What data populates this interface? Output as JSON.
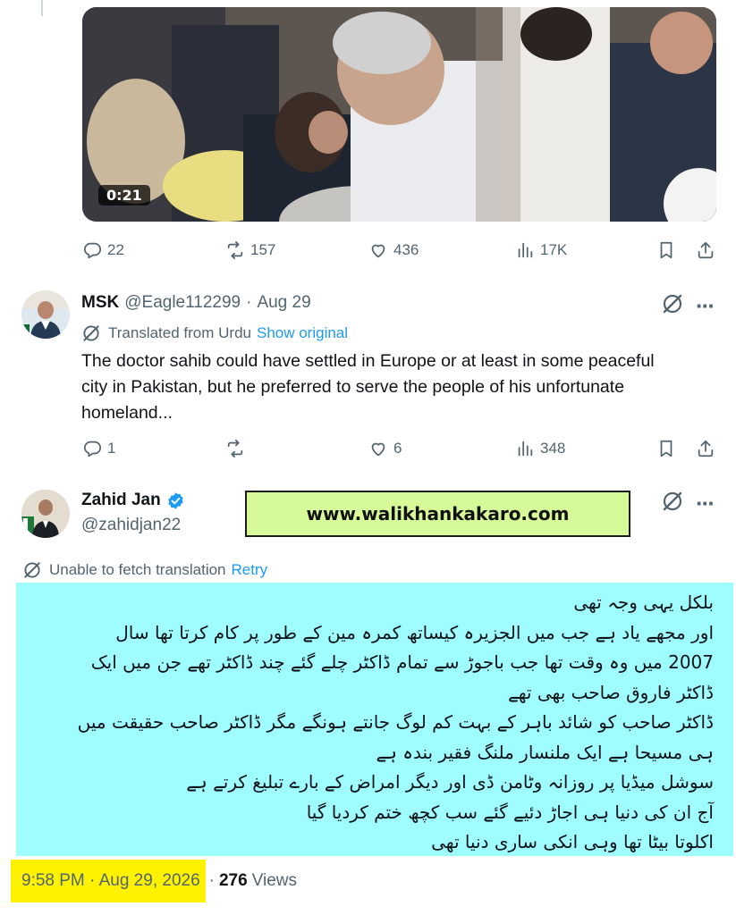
{
  "video": {
    "duration": "0:21"
  },
  "tweet1_actions": {
    "replies": "22",
    "reposts": "157",
    "likes": "436",
    "views": "17K"
  },
  "tweet2": {
    "name": "MSK",
    "handle": "@Eagle112299",
    "separator": "·",
    "date": "Aug 29",
    "translated_label": "Translated from Urdu",
    "show_original": "Show original",
    "text_lines": [
      "The doctor sahib could have settled in Europe or at least in some peaceful",
      "city in Pakistan, but he preferred to serve the people of his unfortunate",
      "homeland..."
    ],
    "actions": {
      "replies": "1",
      "reposts": "",
      "likes": "6",
      "views": "348"
    }
  },
  "tweet3": {
    "name": "Zahid Jan",
    "handle": "@zahidjan22",
    "verified": true,
    "translation_error": "Unable to fetch translation",
    "retry": "Retry",
    "urdu_lines": [
      "بلکل یہی وجہ تھی",
      "اور مجھے یاد ہے جب میں الجزیرہ کیساتھ کمرہ مین کے طور پر کام کرتا تھا سال",
      "2007 میں وہ وقت تھا جب باجوڑ سے تمام ڈاکٹر چلے گئے چند ڈاکٹر تھے جن میں ایک",
      "ڈاکٹر فاروق صاحب بھی تھے",
      "ڈاکٹر صاحب کو شائد باہر کے بہت کم لوگ جانتے ہونگے مگر ڈاکٹر صاحب حقیقت میں",
      "ہی مسیحا ہے ایک ملنسار ملنگ فقیر بندہ ہے",
      "سوشل میڈیا پر روزانہ وٹامن ڈی اور دیگر امراض کے بارے تبلیغ کرتے ہے",
      "آج ان کی دنیا ہی اجاڑ دئیے گئے سب کچھ ختم کردیا گیا",
      "اکلوتا بیٹا تھا وہی انکی ساری دنیا تھی"
    ],
    "timestamp": "9:58 PM · Aug 29, 2026",
    "dot": "·",
    "views_count": "276",
    "views_label": "Views"
  },
  "banner": {
    "text": "www.walikhankakaro.com"
  },
  "colors": {
    "link": "#1d9bf0",
    "secondary_text": "#536471",
    "urdu_bg": "#9ffcff",
    "banner_bg": "#d6f99a",
    "highlight": "#fff200",
    "verified": "#1d9bf0"
  }
}
